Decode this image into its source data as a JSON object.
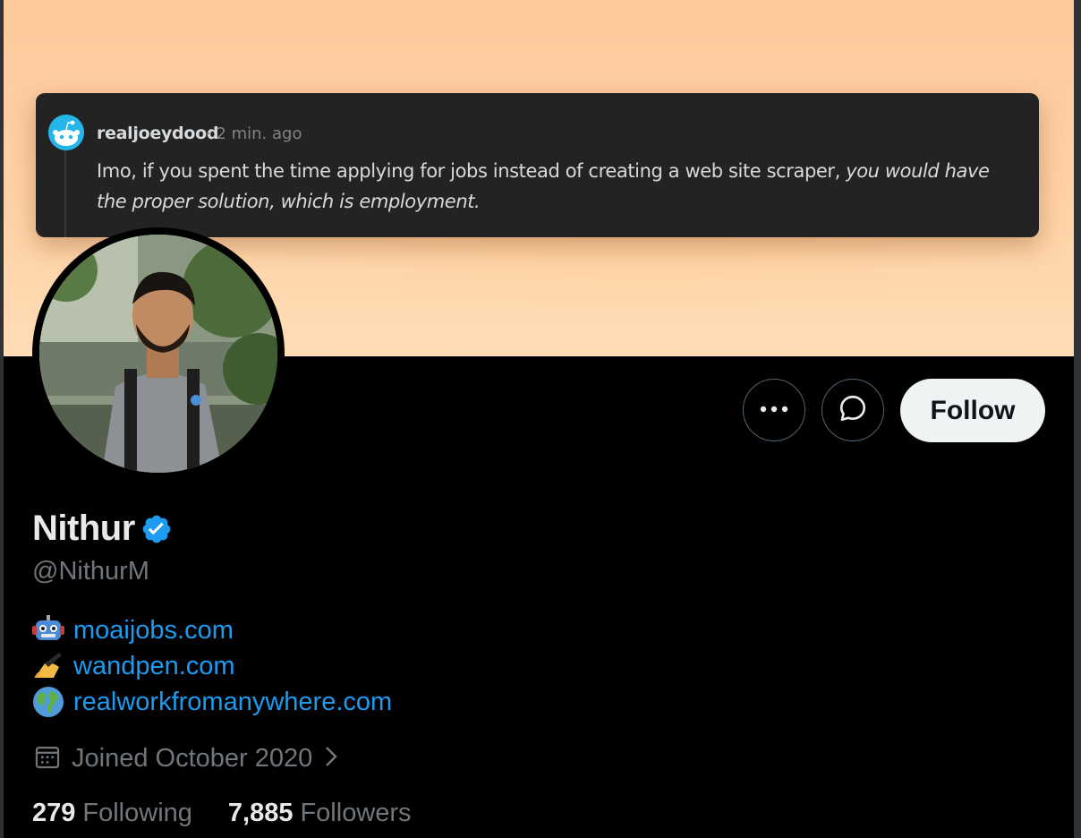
{
  "banner": {
    "comment": {
      "author": "realjoeydood",
      "meta": "· 2 min. ago",
      "text_plain": "Imo, if you spent the time applying for jobs instead of creating a web site scraper, ",
      "text_italic": "you would have the proper solution, which is employment."
    }
  },
  "actions": {
    "more_icon": "more-horizontal-icon",
    "message_icon": "message-bubble-icon",
    "follow_label": "Follow"
  },
  "profile": {
    "name": "Nithur",
    "verified_icon": "verified-badge-icon",
    "handle": "@NithurM",
    "links": [
      {
        "emoji": "robot",
        "text": "moaijobs.com"
      },
      {
        "emoji": "writing-hand",
        "text": "wandpen.com"
      },
      {
        "emoji": "globe",
        "text": "realworkfromanywhere.com"
      }
    ],
    "joined": "Joined October 2020",
    "following_count": "279",
    "following_label": "Following",
    "followers_count": "7,885",
    "followers_label": "Followers"
  },
  "colors": {
    "background": "#000000",
    "link": "#1d9bf0",
    "muted": "#71767b",
    "verified": "#1d9bf0",
    "follow_button_bg": "#eff3f4"
  }
}
